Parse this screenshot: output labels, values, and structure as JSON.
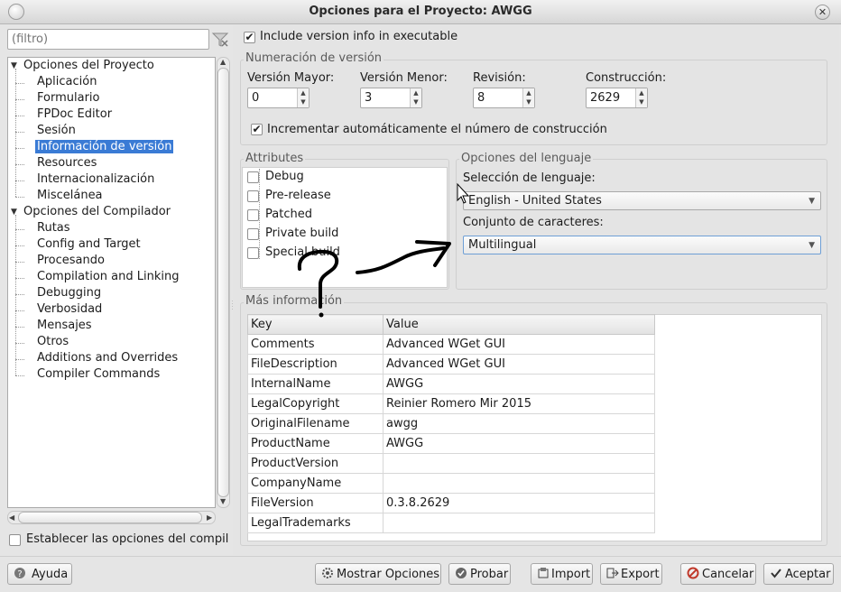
{
  "window": {
    "title": "Opciones para el Proyecto: AWGG",
    "close_glyph": "✕"
  },
  "filter": {
    "placeholder": "(filtro)"
  },
  "tree": {
    "groups": [
      {
        "label": "Opciones del Proyecto",
        "items": [
          "Aplicación",
          "Formulario",
          "FPDoc Editor",
          "Sesión",
          "Información de versión",
          "Resources",
          "Internacionalización",
          "Miscelánea"
        ]
      },
      {
        "label": "Opciones del Compilador",
        "items": [
          "Rutas",
          "Config and Target",
          "Procesando",
          "Compilation and Linking",
          "Debugging",
          "Verbosidad",
          "Mensajes",
          "Otros",
          "Additions and Overrides",
          "Compiler Commands"
        ]
      }
    ],
    "selected": "Información de versión"
  },
  "left_checkbox_label": "Establecer las opciones del compil",
  "include_version": {
    "label": "Include version info in executable",
    "checked": true
  },
  "version_numbering": {
    "title": "Numeración de versión",
    "fields": [
      {
        "label": "Versión Mayor:",
        "value": "0"
      },
      {
        "label": "Versión Menor:",
        "value": "3"
      },
      {
        "label": "Revisión:",
        "value": "8"
      },
      {
        "label": "Construcción:",
        "value": "2629"
      }
    ],
    "auto_increment": {
      "label": "Incrementar automáticamente el número de construcción",
      "checked": true
    }
  },
  "attributes": {
    "title": "Attributes",
    "items": [
      {
        "label": "Debug",
        "checked": false
      },
      {
        "label": "Pre-release",
        "checked": false
      },
      {
        "label": "Patched",
        "checked": false
      },
      {
        "label": "Private build",
        "checked": false
      },
      {
        "label": "Special build",
        "checked": false
      }
    ]
  },
  "language": {
    "title": "Opciones del lenguaje",
    "lang_label": "Selección de lenguaje:",
    "lang_value": "English - United States",
    "charset_label": "Conjunto de caracteres:",
    "charset_value": "Multilingual"
  },
  "more_info": {
    "title": "Más información",
    "columns": [
      "Key",
      "Value"
    ],
    "rows": [
      [
        "Comments",
        "Advanced WGet GUI"
      ],
      [
        "FileDescription",
        "Advanced WGet GUI"
      ],
      [
        "InternalName",
        "AWGG"
      ],
      [
        "LegalCopyright",
        "Reinier Romero Mir 2015"
      ],
      [
        "OriginalFilename",
        "awgg"
      ],
      [
        "ProductName",
        "AWGG"
      ],
      [
        "ProductVersion",
        ""
      ],
      [
        "CompanyName",
        ""
      ],
      [
        "FileVersion",
        "0.3.8.2629"
      ],
      [
        "LegalTrademarks",
        ""
      ]
    ]
  },
  "buttons": {
    "help": "Ayuda",
    "show_options": "Mostrar Opciones",
    "test": "Probar",
    "import": "Import",
    "export": "Export",
    "cancel": "Cancelar",
    "accept": "Aceptar"
  },
  "icons": {
    "help": "help-icon",
    "show_options": "options-icon",
    "test": "check-icon",
    "import": "import-icon",
    "export": "export-icon",
    "cancel": "cancel-icon",
    "accept": "accept-icon"
  },
  "colors": {
    "selection": "#3a7bd5",
    "annotation": "#000000"
  }
}
